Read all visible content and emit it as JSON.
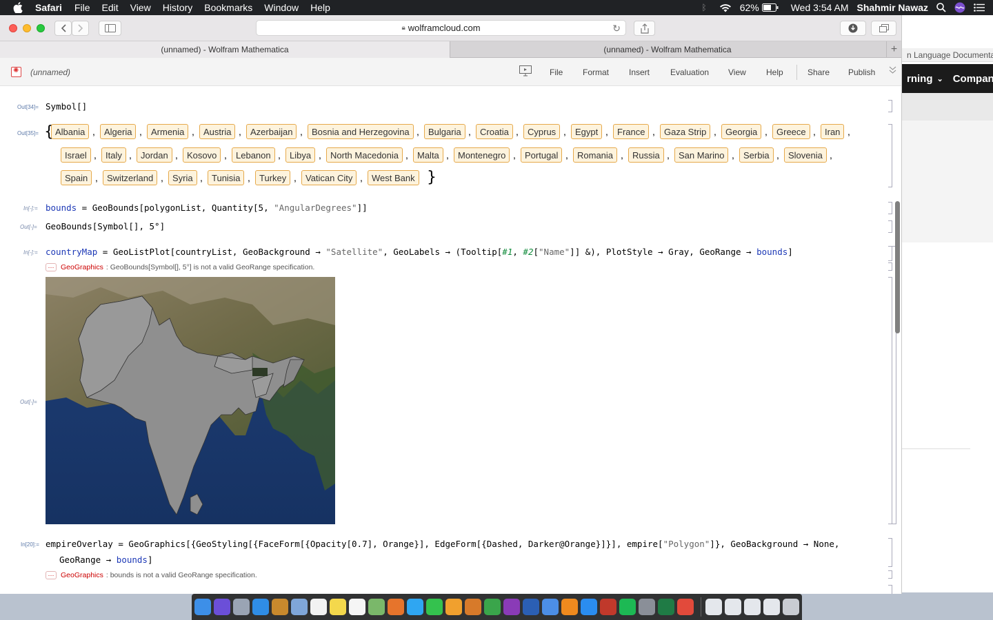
{
  "menubar": {
    "app": "Safari",
    "items": [
      "File",
      "Edit",
      "View",
      "History",
      "Bookmarks",
      "Window",
      "Help"
    ],
    "battery": "62%",
    "clock": "Wed 3:54 AM",
    "user": "Shahmir Nawaz"
  },
  "browser": {
    "url": "wolframcloud.com",
    "tabs": [
      "(unnamed) - Wolfram Mathematica",
      "(unnamed) - Wolfram Mathematica"
    ]
  },
  "background_window": {
    "tab_text": "n Language Documentatio",
    "nav_items": [
      "rning",
      "Compan"
    ]
  },
  "notebook": {
    "name": "(unnamed)",
    "menu": [
      "File",
      "Format",
      "Insert",
      "Evaluation",
      "View",
      "Help",
      "Share",
      "Publish"
    ],
    "cells": {
      "out34_label": "Out[34]=",
      "out34_text": "Symbol[]",
      "out35_label": "Out[35]=",
      "countries": [
        "Albania",
        "Algeria",
        "Armenia",
        "Austria",
        "Azerbaijan",
        "Bosnia and Herzegovina",
        "Bulgaria",
        "Croatia",
        "Cyprus",
        "Egypt",
        "France",
        "Gaza Strip",
        "Georgia",
        "Greece",
        "Iran",
        "Israel",
        "Italy",
        "Jordan",
        "Kosovo",
        "Lebanon",
        "Libya",
        "North Macedonia",
        "Malta",
        "Montenegro",
        "Portugal",
        "Romania",
        "Russia",
        "San Marino",
        "Serbia",
        "Slovenia",
        "Spain",
        "Switzerland",
        "Syria",
        "Tunisia",
        "Turkey",
        "Vatican City",
        "West Bank"
      ],
      "in_bounds_label": "In[-]:=",
      "in_bounds": {
        "var": "bounds",
        "rest": " = GeoBounds[polygonList, Quantity[5, ",
        "str": "\"AngularDegrees\"",
        "end": "]]"
      },
      "out_bounds_label": "Out[-]=",
      "out_bounds": "GeoBounds[Symbol[], 5°]",
      "in_map_label": "In[-]:=",
      "in_map": {
        "var": "countryMap",
        "p1": " = GeoListPlot[countryList, GeoBackground → ",
        "s1": "\"Satellite\"",
        "p2": ", GeoLabels → (Tooltip[",
        "sl1": "#1",
        "p3": ", ",
        "sl2": "#2",
        "p4": "[",
        "s2": "\"Name\"",
        "p5": "]] &), PlotStyle → Gray, GeoRange → ",
        "v2": "bounds",
        "p6": "]"
      },
      "msg1_tag": "GeoGraphics",
      "msg1_text": ": GeoBounds[Symbol[], 5°] is not a valid GeoRange specification.",
      "out_map_label": "Out[-]=",
      "in20_label": "In[20]:=",
      "in20_line1": {
        "var": "empireOverlay",
        "p1": " = GeoGraphics[{GeoStyling[{FaceForm[{Opacity[0.7], Orange}], EdgeForm[{Dashed, Darker@Orange}]}], empire[",
        "s1": "\"Polygon\"",
        "p2": "]}, GeoBackground → None,"
      },
      "in20_line2": {
        "p1": "GeoRange → ",
        "v1": "bounds",
        "p2": "]"
      },
      "msg2_tag": "GeoGraphics",
      "msg2_text": ": bounds is not a valid GeoRange specification."
    }
  },
  "colors": {
    "chip_border": "#e6a94a",
    "chip_bg": "#fdf3dd",
    "symbol_blue": "#1c38b6",
    "error_red": "#cc0000"
  }
}
